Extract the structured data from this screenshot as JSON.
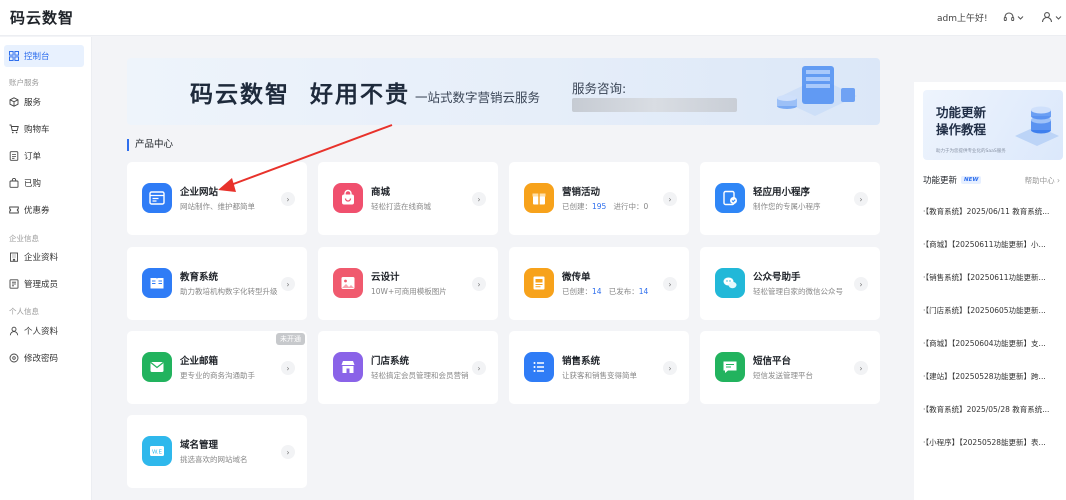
{
  "header": {
    "logo": "码云数智",
    "greeting": "adm上午好!",
    "support_icon": "headset-icon",
    "user_icon": "user-icon"
  },
  "sidebar": {
    "items": [
      {
        "label": "控制台",
        "icon": "dashboard-icon",
        "active": true
      },
      {
        "group": "账户服务"
      },
      {
        "label": "服务",
        "icon": "cube-icon"
      },
      {
        "label": "购物车",
        "icon": "cart-icon"
      },
      {
        "label": "订单",
        "icon": "order-icon"
      },
      {
        "label": "已购",
        "icon": "bag-icon"
      },
      {
        "label": "优惠券",
        "icon": "coupon-icon"
      },
      {
        "group": "企业信息"
      },
      {
        "label": "企业资料",
        "icon": "building-icon"
      },
      {
        "label": "管理成员",
        "icon": "members-icon"
      },
      {
        "group": "个人信息"
      },
      {
        "label": "个人资料",
        "icon": "person-icon"
      },
      {
        "label": "修改密码",
        "icon": "key-icon"
      }
    ]
  },
  "banner": {
    "title": "码云数智  好用不贵",
    "subtitle": "一站式数字营销云服务",
    "consult_label": "服务咨询:"
  },
  "section_title": "产品中心",
  "products": [
    {
      "name": "企业网站",
      "desc": "网站制作、维护都简单",
      "icon": "website-icon",
      "color": "#2f7cf6"
    },
    {
      "name": "商城",
      "desc": "轻松打造在线商城",
      "icon": "shop-bag-icon",
      "color": "#f0506e"
    },
    {
      "name": "营销活动",
      "desc_prefix": "已创建：",
      "desc_num1": "195",
      "desc_mid": "进行中：",
      "desc_num2": "0",
      "icon": "gift-icon",
      "color": "#f7a21b"
    },
    {
      "name": "轻应用小程序",
      "desc": "制作您的专属小程序",
      "icon": "miniapp-icon",
      "color": "#2f86f6"
    },
    {
      "name": "教育系统",
      "desc": "助力教培机构数字化转型升级",
      "icon": "book-icon",
      "color": "#2f7cf6"
    },
    {
      "name": "云设计",
      "desc": "10W+可商用模板图片",
      "icon": "image-icon",
      "color": "#f05a6e"
    },
    {
      "name": "微传单",
      "desc_prefix": "已创建：",
      "desc_num1": "14",
      "desc_mid": "已发布：",
      "desc_num2": "14",
      "icon": "flyer-icon",
      "color": "#f7a21b"
    },
    {
      "name": "公众号助手",
      "desc": "轻松管理自家的微信公众号",
      "icon": "wechat-icon",
      "color": "#22b8d8"
    },
    {
      "name": "企业邮箱",
      "desc": "更专业的商务沟通助手",
      "icon": "mail-icon",
      "color": "#22b35e",
      "tag": "未开通"
    },
    {
      "name": "门店系统",
      "desc": "轻松搞定会员管理和会员营销",
      "icon": "store-icon",
      "color": "#8a63e8"
    },
    {
      "name": "销售系统",
      "desc": "让获客和销售变得简单",
      "icon": "list-icon",
      "color": "#2f7cf6"
    },
    {
      "name": "短信平台",
      "desc": "短信发送管理平台",
      "icon": "sms-icon",
      "color": "#22b35e"
    },
    {
      "name": "域名管理",
      "desc": "挑选喜欢的网站域名",
      "icon": "domain-icon",
      "color": "#2fb8ec"
    }
  ],
  "right_panel": {
    "promo_line1": "功能更新",
    "promo_line2": "操作教程",
    "promo_small": "助力于为您提供专业化的SaaS服务",
    "updates_title": "功能更新",
    "new_badge": "NEW",
    "help_link": "帮助中心 ›",
    "news": [
      "·【教育系统】2025/06/11 教育系统...",
      "·【商城】【20250611功能更新】小...",
      "·【销售系统】【20250611功能更新...",
      "·【门店系统】【20250605功能更新...",
      "·【商城】【20250604功能更新】支...",
      "·【建站】【20250528功能更新】跨...",
      "·【教育系统】2025/05/28 教育系统...",
      "·【小程序】【20250528能更新】表..."
    ]
  },
  "colors": {
    "accent": "#2f6fed",
    "annotation": "#e8322b"
  }
}
